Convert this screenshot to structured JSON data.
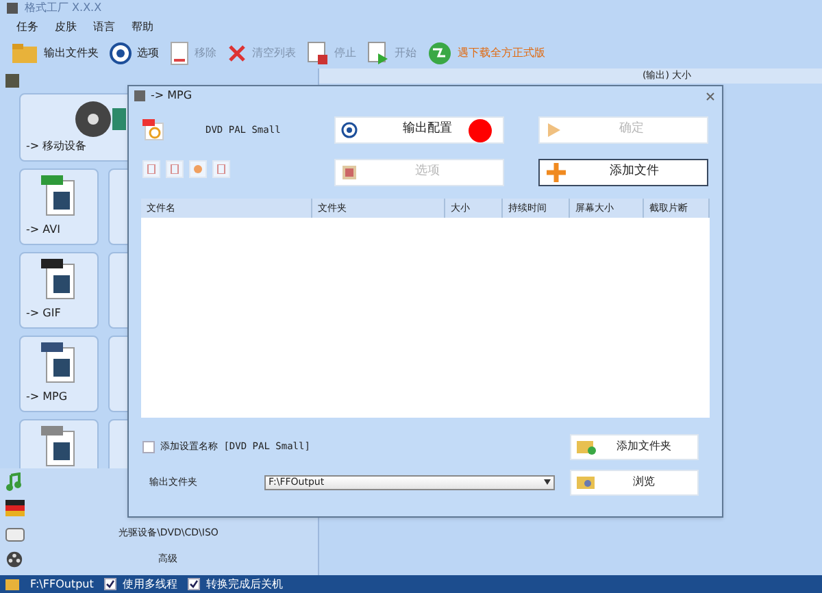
{
  "window": {
    "title": "格式工厂 X.X.X"
  },
  "menu": [
    "任务",
    "皮肤",
    "语言",
    "帮助"
  ],
  "toolbar": [
    {
      "label": "输出文件夹",
      "kind": "folder",
      "disabled": false
    },
    {
      "label": "选项",
      "kind": "options",
      "disabled": false
    },
    {
      "label": "移除",
      "kind": "remove",
      "disabled": true
    },
    {
      "label": "清空列表",
      "kind": "clear",
      "disabled": true
    },
    {
      "label": "停止",
      "kind": "stop",
      "disabled": true
    },
    {
      "label": "开始",
      "kind": "start",
      "disabled": true
    },
    {
      "label": "遇下载全方正式版",
      "kind": "download",
      "disabled": false
    }
  ],
  "task_table": {
    "column_5": "(输出) 大小"
  },
  "sidebar": {
    "category": "-> 移动设备",
    "tiles": [
      {
        "label": "-> AVI",
        "kind": "avi"
      },
      {
        "label": "-> GIF",
        "kind": "gif"
      },
      {
        "label": "-> MPG",
        "kind": "mpg"
      },
      {
        "kind": "other"
      }
    ],
    "groups": [
      {
        "kind": "audio"
      },
      {
        "kind": "image"
      },
      {
        "label": "光驱设备\\DVD\\CD\\ISO",
        "kind": "disc"
      },
      {
        "label": "高级",
        "kind": "advanced"
      }
    ]
  },
  "dialog": {
    "title": "-> MPG",
    "profile": "DVD PAL Small",
    "buttons": [
      {
        "label": "输出配置",
        "kind": "config",
        "disabled": false
      },
      {
        "label": "确定",
        "kind": "ok",
        "disabled": true
      },
      {
        "label": "选项",
        "kind": "options",
        "disabled": true
      },
      {
        "label": "添加文件",
        "kind": "add",
        "disabled": false
      }
    ],
    "columns": [
      "文件名",
      "文件夹",
      "大小",
      "持续时间",
      "屏幕大小",
      "截取片断"
    ],
    "add_name": {
      "label": "添加设置名称 [DVD PAL Small]",
      "checked": false
    },
    "add_folder": "添加文件夹",
    "output_label": "输出文件夹",
    "output_value": "F:\\FFOutput",
    "browse": "浏览"
  },
  "status_bar": {
    "path": "F:\\FFOutput",
    "options": [
      {
        "label": "使用多线程",
        "checked": true
      },
      {
        "label": "转换完成后关机",
        "checked": true
      }
    ]
  }
}
